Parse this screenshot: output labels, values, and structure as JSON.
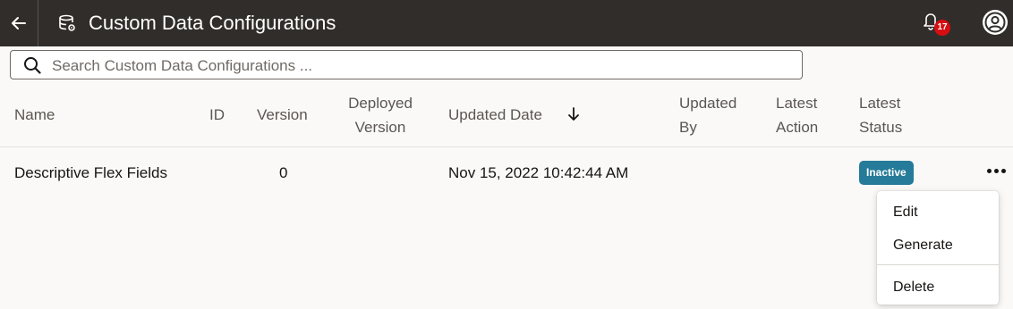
{
  "header": {
    "title": "Custom Data Configurations",
    "notification_count": "17"
  },
  "search": {
    "placeholder": "Search Custom Data Configurations ..."
  },
  "table": {
    "columns": {
      "name": "Name",
      "id": "ID",
      "version": "Version",
      "deployed_version_1": "Deployed",
      "deployed_version_2": "Version",
      "updated_date": "Updated Date",
      "updated_by_1": "Updated",
      "updated_by_2": "By",
      "latest_action_1": "Latest",
      "latest_action_2": "Action",
      "latest_status_1": "Latest",
      "latest_status_2": "Status"
    },
    "rows": [
      {
        "name": "Descriptive Flex Fields",
        "id": "",
        "version": "0",
        "deployed_version": "",
        "updated_date": "Nov 15, 2022 10:42:44 AM",
        "updated_by": "",
        "latest_action": "",
        "latest_status": "Inactive"
      }
    ]
  },
  "menu": {
    "items": [
      "Edit",
      "Generate",
      "Delete"
    ]
  },
  "colors": {
    "header_bg": "#312d2a",
    "badge_red": "#d80d12",
    "status_inactive": "#257b99"
  },
  "icons": {
    "back": "arrow-left-icon",
    "app": "data-config-icon",
    "notifications": "bell-icon",
    "profile": "user-avatar-icon",
    "search": "search-icon",
    "sort": "arrow-down-icon",
    "actions": "more-horizontal-icon"
  }
}
